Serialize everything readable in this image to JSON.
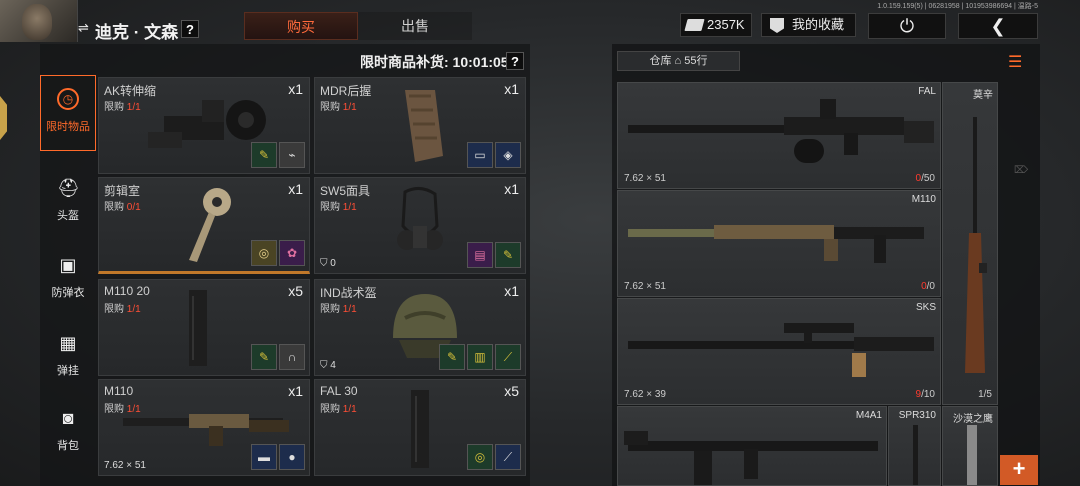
{
  "header": {
    "player_name": "迪克 · 文森",
    "help": "?",
    "tabs": [
      {
        "label": "购买",
        "active": true
      },
      {
        "label": "出售",
        "active": false
      }
    ],
    "cash": "2357K",
    "favorites": "我的收藏",
    "version": "1.0.159.159(5) | 06281958 | 101953986694 | 温路-5"
  },
  "shop": {
    "restock_label": "限时商品补货: 10:01:05",
    "categories": [
      {
        "label": "限时物品",
        "icon": "clock-icon",
        "active": true
      },
      {
        "label": "头盔",
        "icon": "helmet-icon",
        "active": false
      },
      {
        "label": "防弹衣",
        "icon": "vest-icon",
        "active": false
      },
      {
        "label": "弹挂",
        "icon": "rig-icon",
        "active": false
      },
      {
        "label": "背包",
        "icon": "backpack-icon",
        "active": false
      }
    ],
    "items": [
      {
        "name": "AK转伸缩",
        "limit_label": "限购",
        "limit": "1/1",
        "qty": "x1",
        "mats": [
          "screw-icon",
          "wire-icon"
        ]
      },
      {
        "name": "MDR后握",
        "limit_label": "限购",
        "limit": "1/1",
        "qty": "x1",
        "mats": [
          "cloth-icon",
          "metal-plate-icon"
        ]
      },
      {
        "name": "剪辑室",
        "limit_label": "限购",
        "limit": "0/1",
        "qty": "x1",
        "mats": [
          "tape-icon",
          "flower-icon"
        ]
      },
      {
        "name": "SW5面具",
        "limit_label": "限购",
        "limit": "1/1",
        "qty": "x1",
        "armor": "0",
        "mats": [
          "fabric-icon",
          "screw-icon"
        ]
      },
      {
        "name": "M110 20",
        "limit_label": "限购",
        "limit": "1/1",
        "qty": "x5",
        "mats": [
          "screw-icon",
          "magnet-icon"
        ]
      },
      {
        "name": "IND战术盔",
        "limit_label": "限购",
        "limit": "1/1",
        "qty": "x1",
        "armor": "4",
        "mats": [
          "screw-icon",
          "money-icon",
          "knife-icon"
        ]
      },
      {
        "name": "M110",
        "limit_label": "限购",
        "limit": "1/1",
        "qty": "x1",
        "caliber": "7.62 × 51",
        "mats": [
          "soap-icon",
          "coin-icon"
        ]
      },
      {
        "name": "FAL 30",
        "limit_label": "限购",
        "limit": "1/1",
        "qty": "x5",
        "mats": [
          "tape-icon",
          "wrench-icon"
        ]
      }
    ]
  },
  "warehouse": {
    "label": "仓库",
    "rows": "55行",
    "guns": [
      {
        "name": "FAL",
        "caliber": "7.62 × 51",
        "ammo_cur": "0",
        "ammo_max": "/50"
      },
      {
        "name": "M110",
        "caliber": "7.62 × 51",
        "ammo_cur": "0",
        "ammo_max": "/0"
      },
      {
        "name": "SKS",
        "caliber": "7.62 × 39",
        "ammo_cur": "9",
        "ammo_max": "/10"
      },
      {
        "name": "M4A1",
        "caliber": "",
        "ammo_cur": "",
        "ammo_max": ""
      },
      {
        "name": "莫辛",
        "caliber": "",
        "ammo_cur": "1",
        "ammo_max": "/5"
      },
      {
        "name": "SPR310",
        "caliber": "",
        "ammo_cur": "",
        "ammo_max": ""
      },
      {
        "name": "沙漠之鹰",
        "caliber": "",
        "ammo_cur": "",
        "ammo_max": ""
      }
    ],
    "add_label": "+"
  }
}
